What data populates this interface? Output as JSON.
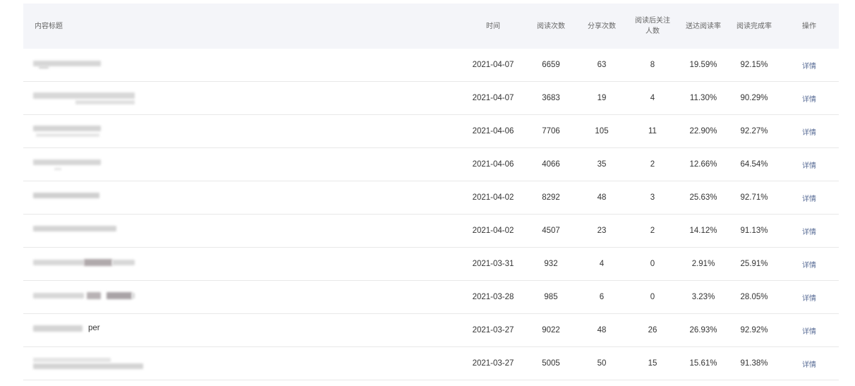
{
  "table": {
    "headers": {
      "title": "内容标题",
      "time": "时间",
      "reads": "阅读次数",
      "shares": "分享次数",
      "follows_line1": "阅读后关注",
      "follows_line2": "人数",
      "delivery_rate": "送达阅读率",
      "completion_rate": "阅读完成率",
      "action": "操作"
    },
    "rows": [
      {
        "title_tail": "",
        "time": "2021-04-07",
        "reads": "6659",
        "shares": "63",
        "follows": "8",
        "delivery_rate": "19.59%",
        "completion_rate": "92.15%",
        "action": "详情"
      },
      {
        "title_tail": "",
        "time": "2021-04-07",
        "reads": "3683",
        "shares": "19",
        "follows": "4",
        "delivery_rate": "11.30%",
        "completion_rate": "90.29%",
        "action": "详情"
      },
      {
        "title_tail": "",
        "time": "2021-04-06",
        "reads": "7706",
        "shares": "105",
        "follows": "11",
        "delivery_rate": "22.90%",
        "completion_rate": "92.27%",
        "action": "详情"
      },
      {
        "title_tail": "",
        "time": "2021-04-06",
        "reads": "4066",
        "shares": "35",
        "follows": "2",
        "delivery_rate": "12.66%",
        "completion_rate": "64.54%",
        "action": "详情"
      },
      {
        "title_tail": "",
        "time": "2021-04-02",
        "reads": "8292",
        "shares": "48",
        "follows": "3",
        "delivery_rate": "25.63%",
        "completion_rate": "92.71%",
        "action": "详情"
      },
      {
        "title_tail": "",
        "time": "2021-04-02",
        "reads": "4507",
        "shares": "23",
        "follows": "2",
        "delivery_rate": "14.12%",
        "completion_rate": "91.13%",
        "action": "详情"
      },
      {
        "title_tail": "",
        "time": "2021-03-31",
        "reads": "932",
        "shares": "4",
        "follows": "0",
        "delivery_rate": "2.91%",
        "completion_rate": "25.91%",
        "action": "详情"
      },
      {
        "title_tail": "",
        "time": "2021-03-28",
        "reads": "985",
        "shares": "6",
        "follows": "0",
        "delivery_rate": "3.23%",
        "completion_rate": "28.05%",
        "action": "详情"
      },
      {
        "title_tail": "per",
        "time": "2021-03-27",
        "reads": "9022",
        "shares": "48",
        "follows": "26",
        "delivery_rate": "26.93%",
        "completion_rate": "92.92%",
        "action": "详情"
      },
      {
        "title_tail": "",
        "time": "2021-03-27",
        "reads": "5005",
        "shares": "50",
        "follows": "15",
        "delivery_rate": "15.61%",
        "completion_rate": "91.38%",
        "action": "详情"
      }
    ]
  },
  "colors": {
    "header_bg": "#f4f5f9",
    "link": "#576b95",
    "row_border": "#e8e8e8"
  }
}
